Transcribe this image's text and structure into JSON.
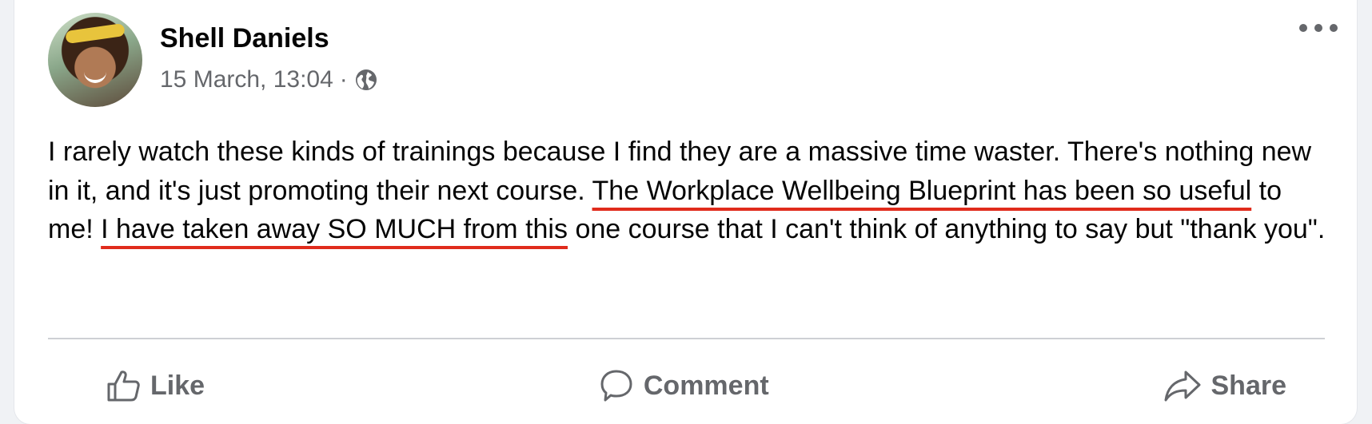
{
  "post": {
    "author": "Shell Daniels",
    "timestamp": "15 March, 13:04",
    "separator": "·",
    "audience_icon": "globe-icon",
    "more_icon": "more-options-icon",
    "text_segments": [
      {
        "text": "I rarely watch these kinds of trainings because I find they are a massive time waster. There's nothing new in it, and it's just promoting their next course. ",
        "highlight": false
      },
      {
        "text": "The Workplace Wellbeing Blueprint has been so useful",
        "highlight": true
      },
      {
        "text": " to me! ",
        "highlight": false
      },
      {
        "text": "I have taken away SO MUCH from this",
        "highlight": true
      },
      {
        "text": " one course that I can't think of anything to say but \"thank you\".",
        "highlight": false
      }
    ]
  },
  "actions": {
    "like_label": "Like",
    "comment_label": "Comment",
    "share_label": "Share"
  },
  "colors": {
    "underline": "#e02b1c",
    "secondary_text": "#65676b"
  }
}
